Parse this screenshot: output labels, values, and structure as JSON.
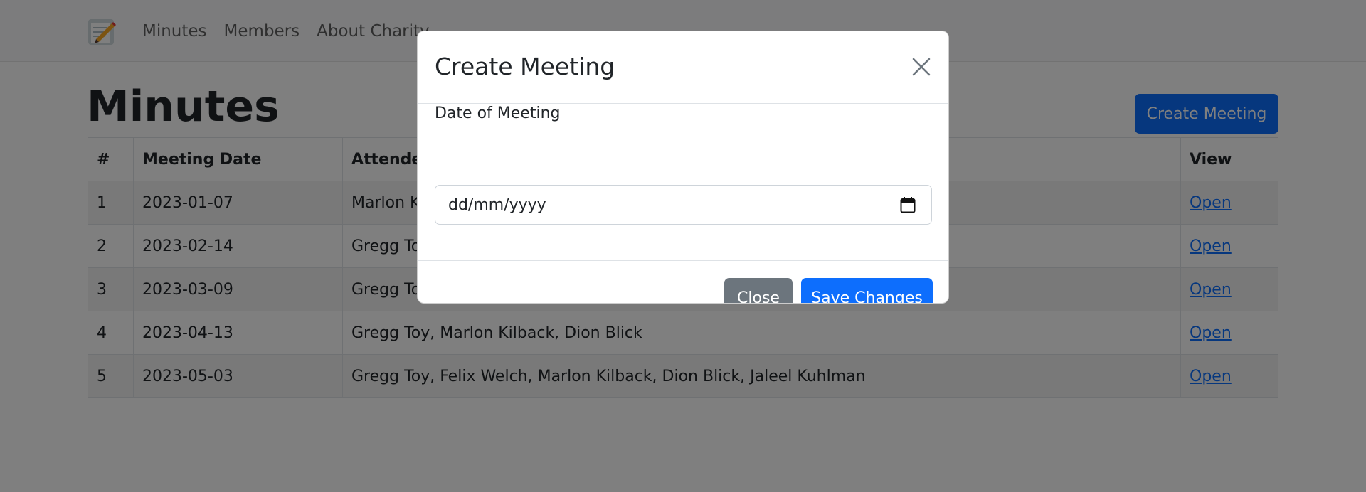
{
  "nav": {
    "brand_icon": "notepad-pencil-icon",
    "links": [
      "Minutes",
      "Members",
      "About Charity"
    ]
  },
  "page": {
    "title": "Minutes",
    "create_button_label": "Create Meeting"
  },
  "table": {
    "headers": [
      "#",
      "Meeting Date",
      "Attendees",
      "View"
    ],
    "rows": [
      {
        "num": "1",
        "date": "2023-01-07",
        "attendees": "Marlon K",
        "view": "Open"
      },
      {
        "num": "2",
        "date": "2023-02-14",
        "attendees": "Gregg To",
        "view": "Open"
      },
      {
        "num": "3",
        "date": "2023-03-09",
        "attendees": "Gregg To",
        "view": "Open"
      },
      {
        "num": "4",
        "date": "2023-04-13",
        "attendees": "Gregg Toy, Marlon Kilback, Dion Blick",
        "view": "Open"
      },
      {
        "num": "5",
        "date": "2023-05-03",
        "attendees": "Gregg Toy, Felix Welch, Marlon Kilback, Dion Blick, Jaleel Kuhlman",
        "view": "Open"
      }
    ]
  },
  "modal": {
    "title": "Create Meeting",
    "field_label": "Date of Meeting",
    "date_placeholder": "dd/mm/yyyy",
    "close_label": "Close",
    "save_label": "Save Changes"
  },
  "colors": {
    "primary": "#0d6efd",
    "secondary": "#6c757d",
    "backdrop": "rgba(0,0,0,0.5)"
  }
}
